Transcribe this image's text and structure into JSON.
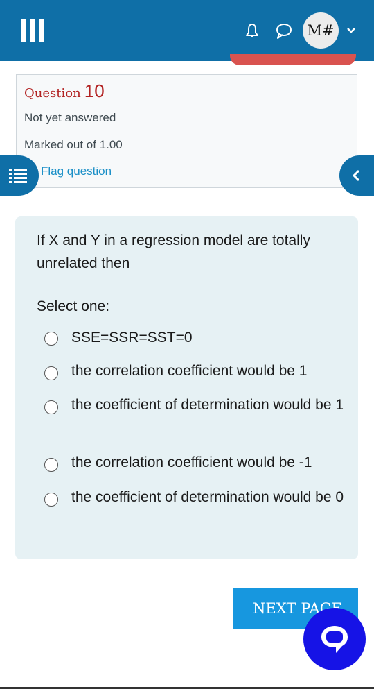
{
  "header": {
    "menu_icon": "hamburger-icon",
    "bell_icon": "bell-icon",
    "messages_icon": "chat-bubble-icon",
    "avatar_initials": "M#",
    "user_menu_icon": "chevron-down-icon",
    "bar_color": "#0f6fa7"
  },
  "question_info": {
    "question_word": "Question",
    "question_number": "10",
    "status": "Not yet answered",
    "marked_out_of": "Marked out of 1.00",
    "flag_label": "Flag question"
  },
  "question": {
    "text": "If X and Y in a regression model are totally unrelated then",
    "select_prompt": "Select one:",
    "options": [
      {
        "label": "SSE=SSR=SST=0",
        "selected": false
      },
      {
        "label": "the correlation coefficient would be 1",
        "selected": false
      },
      {
        "label": "the coefficient of determination would be 1",
        "selected": false
      },
      {
        "label": "the correlation coefficient would be -1",
        "selected": false
      },
      {
        "label": "the coefficient of determination would be 0",
        "selected": false
      }
    ]
  },
  "navigation": {
    "next_button": "NEXT PAGE",
    "drawer_icon": "quiz-navigation-icon",
    "collapse_icon": "chevron-left-icon",
    "chat_icon": "chat-support-icon"
  }
}
